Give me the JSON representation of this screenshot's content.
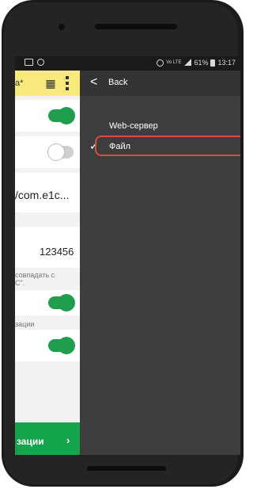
{
  "status_bar": {
    "battery": "61%",
    "time": "13:17",
    "network": "Vo LTE"
  },
  "background_app": {
    "header_title": "а*",
    "card_value_url": "/com.e1c...",
    "card_value_number": "123456",
    "note_line1": "совпадать с",
    "note_line2": "С\".",
    "note_line3": "зации",
    "action_button_label": "зации",
    "action_button_chevron": "›",
    "toggles": [
      {
        "state": "on"
      },
      {
        "state": "off"
      },
      {
        "state": "on"
      },
      {
        "state": "on"
      }
    ]
  },
  "menu": {
    "back_label": "Back",
    "items": [
      {
        "label": "Web-сервер",
        "checked": false
      },
      {
        "label": "Файл",
        "checked": true,
        "highlighted": true
      }
    ],
    "check_glyph": "✓",
    "back_glyph": "<"
  },
  "colors": {
    "accent_green": "#14a54c",
    "header_yellow": "#f7e97b",
    "highlight_red": "#e04a3c",
    "menu_bg": "#3d3d3d"
  }
}
